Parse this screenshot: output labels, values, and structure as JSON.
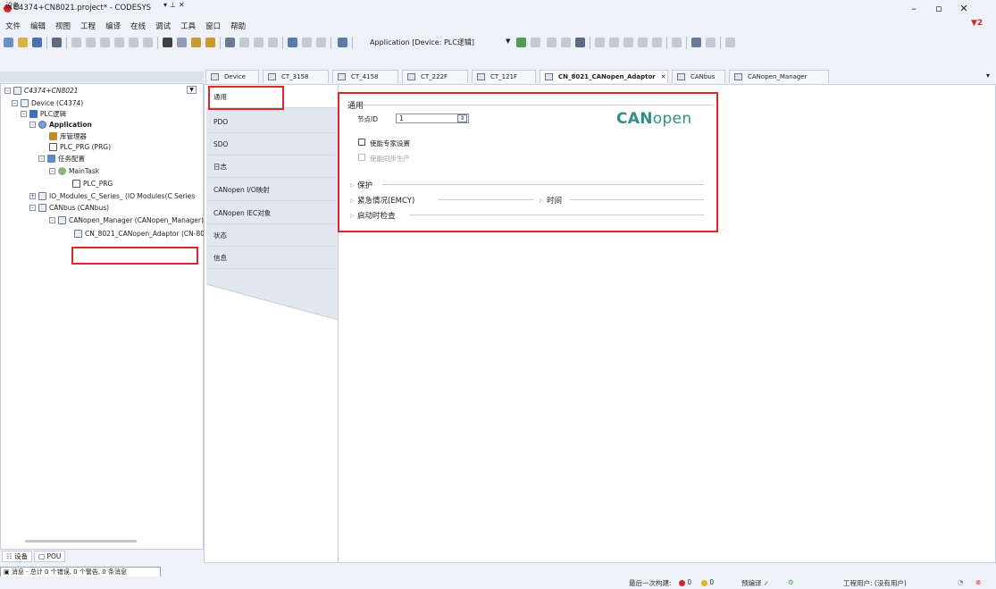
{
  "window": {
    "title": "C4374+CN8021.project* - CODESYS",
    "notify_count": "2"
  },
  "menu": [
    "文件",
    "编辑",
    "视图",
    "工程",
    "编译",
    "在线",
    "调试",
    "工具",
    "窗口",
    "帮助"
  ],
  "toolbar": {
    "application_selector": "Application [Device: PLC逻辑]"
  },
  "devices_panel": {
    "title": "设备",
    "tree": [
      {
        "label": "C4374+CN8021",
        "italic": true
      },
      {
        "label": "Device (C4374)"
      },
      {
        "label": "PLC逻辑"
      },
      {
        "label": "Application",
        "bold": true
      },
      {
        "label": "库管理器"
      },
      {
        "label": "PLC_PRG (PRG)"
      },
      {
        "label": "任务配置"
      },
      {
        "label": "MainTask"
      },
      {
        "label": "PLC_PRG"
      },
      {
        "label": "IO_Modules_C_Series_ (IO Modules(C Series"
      },
      {
        "label": "CANbus (CANbus)"
      },
      {
        "label": "CANopen_Manager (CANopen_Manager)"
      },
      {
        "label": "CN_8021_CANopen_Adaptor (CN-80"
      }
    ],
    "bottom_tabs": [
      "设备",
      "POU"
    ],
    "messages": "消息 - 总计 0 个错误, 0 个警告, 0 条消息"
  },
  "editor_tabs": [
    {
      "label": "Device"
    },
    {
      "label": "CT_3158"
    },
    {
      "label": "CT_4158"
    },
    {
      "label": "CT_222F"
    },
    {
      "label": "CT_121F"
    },
    {
      "label": "CN_8021_CANopen_Adaptor",
      "active": true
    },
    {
      "label": "CANbus"
    },
    {
      "label": "CANopen_Manager"
    }
  ],
  "side_tabs": [
    "通用",
    "PDO",
    "SDO",
    "日志",
    "CANopen I/O映射",
    "CANopen IEC对象",
    "状态",
    "信息"
  ],
  "general": {
    "section_title": "通用",
    "node_id_label": "节点ID",
    "node_id_value": "1",
    "expert_settings_label": "使能专家设置",
    "sync_production_label": "使能同步生产",
    "guarding_title": "保护",
    "emcy_title": "紧急情况(EMCY)",
    "time_title": "时间",
    "bootup_title": "启动时检查",
    "logo_can": "CAN",
    "logo_open": "open"
  },
  "statusbar": {
    "last_build": "最后一次构建:",
    "errors": "0",
    "warnings": "0",
    "precompile": "预编译",
    "project_user": "工程用户: (没有用户)"
  },
  "colors": {
    "highlight": "#e0262b",
    "canopen": "#2f8f86"
  }
}
